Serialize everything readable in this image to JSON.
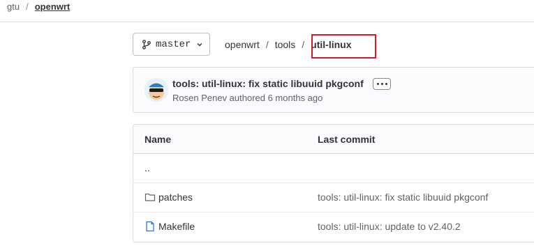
{
  "breadcrumb": {
    "group": "gtu",
    "project": "openwrt"
  },
  "branch_selector": {
    "label": "master"
  },
  "path": {
    "root": "openwrt",
    "dir": "tools",
    "current": "util-linux"
  },
  "last_commit": {
    "title": "tools: util-linux: fix static libuuid pkgconf",
    "meta": "Rosen Penev authored 6 months ago"
  },
  "table": {
    "headers": {
      "name": "Name",
      "last_commit": "Last commit"
    },
    "rows": [
      {
        "name": "..",
        "icon": "",
        "commit": ""
      },
      {
        "name": "patches",
        "icon": "folder-icon",
        "commit": "tools: util-linux: fix static libuuid pkgconf"
      },
      {
        "name": "Makefile",
        "icon": "file-icon",
        "commit": "tools: util-linux: update to v2.40.2"
      }
    ]
  },
  "colors": {
    "highlight": "#d11a2a",
    "file_icon": "#1f75cb"
  }
}
